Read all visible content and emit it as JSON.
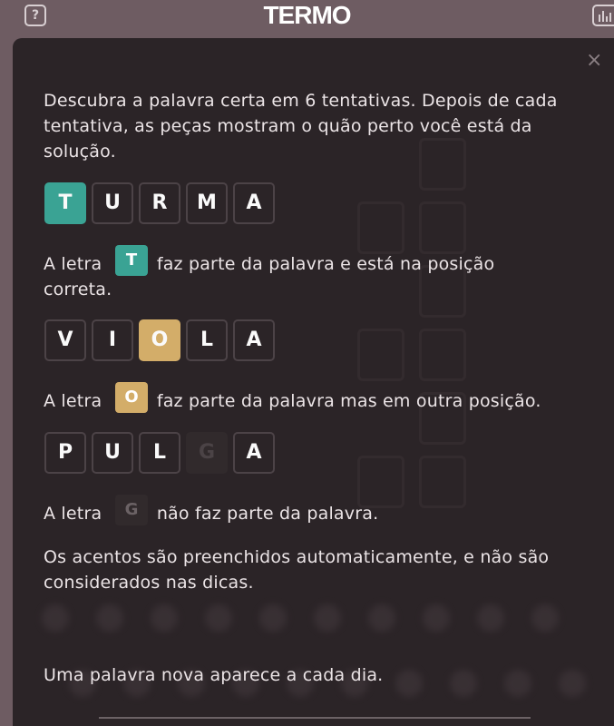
{
  "header": {
    "help_label": "?",
    "logo": "TERMO"
  },
  "modal": {
    "close_label": "×",
    "intro": "Descubra a palavra certa em 6 tentativas. Depois de cada tentativa, as peças mostram o quão perto você está da solução.",
    "examples": [
      {
        "letters": [
          "T",
          "U",
          "R",
          "M",
          "A"
        ],
        "states": [
          "right",
          "",
          "",
          "",
          ""
        ],
        "hint_prefix": "A letra",
        "hint_letter": "T",
        "hint_state": "right",
        "hint_suffix": "faz parte da palavra e está na posição",
        "hint_suffix2": "correta."
      },
      {
        "letters": [
          "V",
          "I",
          "O",
          "L",
          "A"
        ],
        "states": [
          "",
          "",
          "place",
          "",
          ""
        ],
        "hint_prefix": "A letra",
        "hint_letter": "O",
        "hint_state": "place",
        "hint_suffix": "faz parte da palavra mas em outra posição."
      },
      {
        "letters": [
          "P",
          "U",
          "L",
          "G",
          "A"
        ],
        "states": [
          "",
          "",
          "",
          "wrong",
          ""
        ],
        "hint_prefix": "A letra",
        "hint_letter": "G",
        "hint_state": "wrong",
        "hint_suffix": "não faz parte da palavra."
      }
    ],
    "accents_note": "Os acentos são preenchidos automaticamente, e não são considerados nas dicas.",
    "daily_note": "Uma palavra nova aparece a cada dia."
  },
  "colors": {
    "right": "#3aa394",
    "place": "#d3ad69",
    "wrong": "#312a2c",
    "background": "#6e5c62",
    "modal": "#2b2427"
  },
  "icons": [
    "help-icon",
    "stats-icon",
    "close-icon"
  ]
}
